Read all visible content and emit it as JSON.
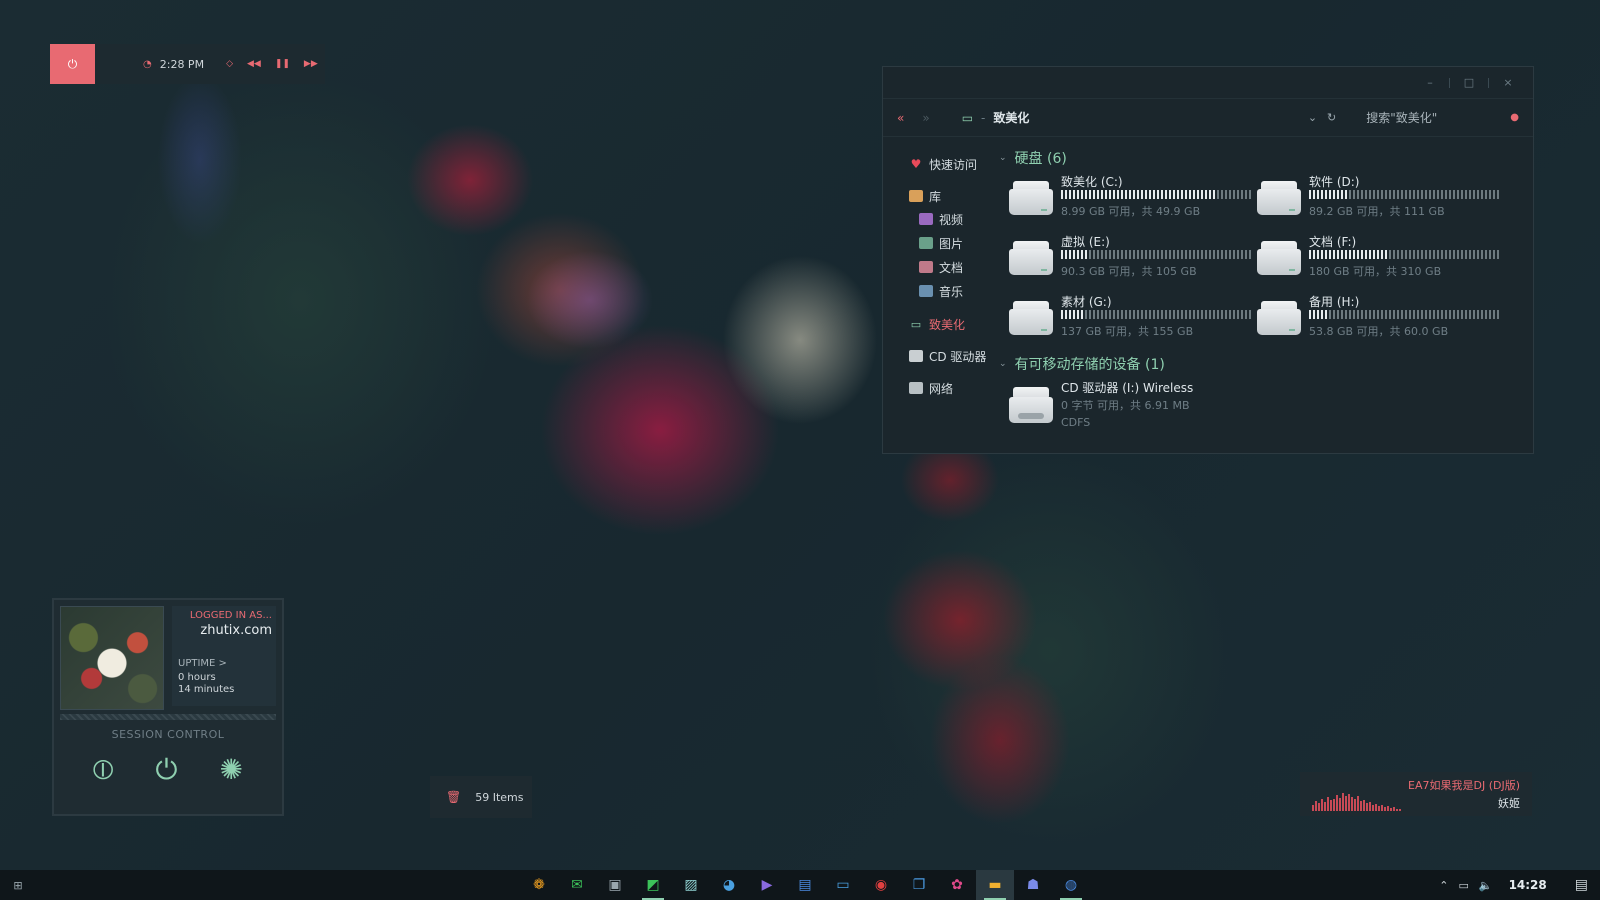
{
  "topbar": {
    "power_icon": "power-icon",
    "clock_icon": "clock-icon",
    "time": "2:28 PM",
    "controls": [
      "shuffle-icon",
      "previous-icon",
      "pause-icon",
      "next-icon"
    ],
    "accent": "#e86a72"
  },
  "explorer": {
    "window_controls": {
      "minimize": "–",
      "maximize": "□",
      "close": "×"
    },
    "nav": {
      "back": "«",
      "forward": "»"
    },
    "path": {
      "separator": "-",
      "title": "致美化"
    },
    "dropdown": "⌄",
    "refresh": "↻",
    "search_placeholder": "搜索\"致美化\"",
    "sidebar": {
      "quick_access": "快速访问",
      "library": "库",
      "library_items": [
        "视频",
        "图片",
        "文档",
        "音乐"
      ],
      "this_pc": "致美化",
      "cd_drive": "CD 驱动器",
      "network": "网络"
    },
    "hard_disks_header": "硬盘 (6)",
    "drives": [
      {
        "name": "致美化 (C:)",
        "caption": "8.99 GB 可用，共 49.9 GB",
        "used_fraction": 0.82
      },
      {
        "name": "软件 (D:)",
        "caption": "89.2 GB 可用，共 111 GB",
        "used_fraction": 0.2
      },
      {
        "name": "虚拟 (E:)",
        "caption": "90.3 GB 可用，共 105 GB",
        "used_fraction": 0.14
      },
      {
        "name": "文档 (F:)",
        "caption": "180 GB 可用，共 310 GB",
        "used_fraction": 0.42
      },
      {
        "name": "素材 (G:)",
        "caption": "137 GB 可用，共 155 GB",
        "used_fraction": 0.12
      },
      {
        "name": "备用 (H:)",
        "caption": "53.8 GB 可用，共 60.0 GB",
        "used_fraction": 0.1
      }
    ],
    "removable_header": "有可移动存储的设备 (1)",
    "cd": {
      "name": "CD 驱动器 (I:) Wireless",
      "caption": "0 字节 可用，共 6.91 MB",
      "fs": "CDFS"
    }
  },
  "session": {
    "logged_label": "LOGGED IN AS...",
    "user": "zhutix.com",
    "uptime_label": "UPTIME >",
    "hours": "0 hours",
    "minutes": "14 minutes",
    "control_title": "SESSION CONTROL",
    "buttons": [
      "lock-icon",
      "power-icon",
      "settings-icon"
    ]
  },
  "trash": {
    "count": "59 Items"
  },
  "music": {
    "song": "EA7如果我是DJ (DJ版)",
    "artist": "妖姬",
    "levels": [
      0.3,
      0.5,
      0.4,
      0.6,
      0.45,
      0.7,
      0.55,
      0.6,
      0.8,
      0.65,
      0.9,
      0.75,
      0.85,
      0.7,
      0.6,
      0.75,
      0.5,
      0.55,
      0.4,
      0.45,
      0.3,
      0.35,
      0.25,
      0.3,
      0.2,
      0.25,
      0.15,
      0.2,
      0.12,
      0.1
    ]
  },
  "taskbar": {
    "time": "14:28",
    "apps": [
      {
        "icon": "paint-bucket-icon",
        "color": "#f0a020"
      },
      {
        "icon": "wechat-icon",
        "color": "#3cc25a"
      },
      {
        "icon": "photoshop-icon",
        "color": "#9aa7ae"
      },
      {
        "icon": "image-editor-icon",
        "color": "#3cc25a",
        "running": true
      },
      {
        "icon": "photos-icon",
        "color": "#8fd0d0"
      },
      {
        "icon": "palette-icon",
        "color": "#4aa0e0"
      },
      {
        "icon": "media-player-icon",
        "color": "#8a6ae0"
      },
      {
        "icon": "notes-icon",
        "color": "#4a8ae0"
      },
      {
        "icon": "terminal-icon",
        "color": "#4aa0e0"
      },
      {
        "icon": "netease-music-icon",
        "color": "#e04040"
      },
      {
        "icon": "virtual-desktop-icon",
        "color": "#4a9ae0"
      },
      {
        "icon": "xiu-icon",
        "color": "#e04a8a"
      },
      {
        "icon": "file-explorer-icon",
        "color": "#f0b030",
        "running": true,
        "active": true
      },
      {
        "icon": "qq-icon",
        "color": "#7a8ae8"
      },
      {
        "icon": "browser-icon",
        "color": "#4a8ae0",
        "running": true
      }
    ]
  }
}
